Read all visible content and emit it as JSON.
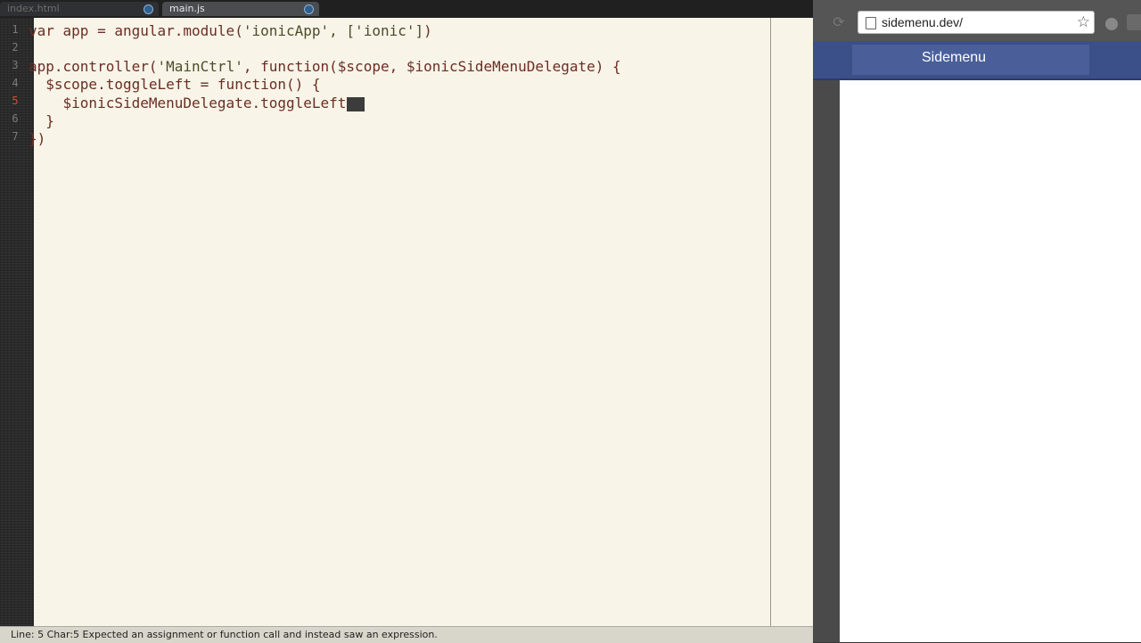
{
  "editor": {
    "tabs": [
      {
        "label": "index.html",
        "active": false
      },
      {
        "label": "main.js",
        "active": true
      }
    ],
    "line_numbers": [
      "1",
      "2",
      "3",
      "4",
      "5",
      "6",
      "7"
    ],
    "current_line": "5",
    "code": [
      {
        "pre": "var app = angular.module(",
        "str": "'ionicApp', ['ionic']",
        "post": ")"
      },
      {
        "pre": "",
        "str": "",
        "post": ""
      },
      {
        "pre": "app.controller(",
        "str": "'MainCtrl'",
        "post": ", function($scope, $ionicSideMenuDelegate) {"
      },
      {
        "pre": "  $scope.toggleLeft = function() {",
        "str": "",
        "post": ""
      },
      {
        "pre": "    $ionicSideMenuDelegate.toggleLeft",
        "str": "",
        "post": ""
      },
      {
        "pre": "  }",
        "str": "",
        "post": ""
      },
      {
        "pre": "})",
        "str": "",
        "post": ""
      }
    ],
    "status_text": "Line: 5 Char:5 Expected an assignment or function call and instead saw an expression."
  },
  "browser": {
    "url": "sidemenu.dev/",
    "header_title": "Sidemenu",
    "header_color": "#3b4f88"
  }
}
